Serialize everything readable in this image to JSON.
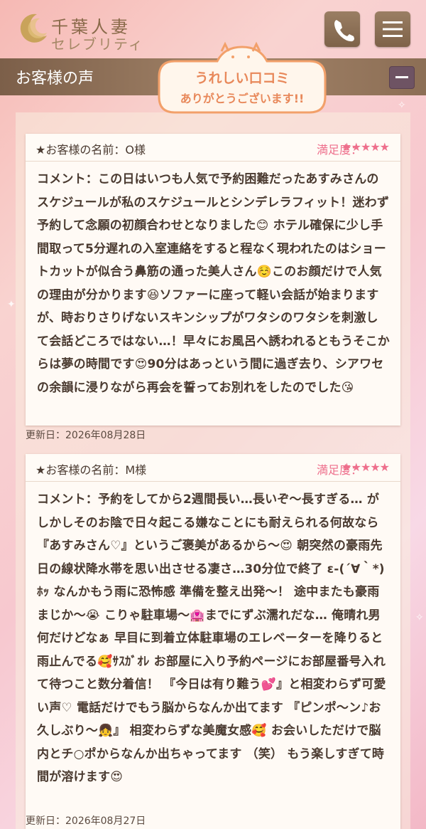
{
  "header": {
    "logo_line1": "千葉人妻",
    "logo_line2": "セレブリティ",
    "phone_icon": "phone-icon",
    "menu_icon": "hamburger-menu-icon"
  },
  "section": {
    "title": "お客様の声",
    "badge_line1": "うれしい口コミ",
    "badge_line2": "ありがとうございます!!",
    "collapse_icon": "minus-icon"
  },
  "reviews": [
    {
      "name": "★お客様の名前：O様",
      "rating_label": "満足度：",
      "stars": "★★★★★",
      "comment": "コメント：この日はいつも人気で予約困難だったあすみさんのスケジュールが私のスケジュールとシンデレラフィット！迷わず予約して念願の初顔合わせとなりました😊 ホテル確保に少し手間取って5分遅れの入室連絡をすると程なく現われたのはショートカットが似合う鼻筋の通った美人さん☺️このお顔だけで人気の理由が分かります😆ソファーに座って軽い会話が始まりますが、時おりさりげないスキンシップがワタシのワタシを刺激して会話どころではない…！早々にお風呂へ誘われるともうそこからは夢の時間です😍90分はあっという間に過ぎ去り、シアワセの余韻に浸りながら再会を誓ってお別れをしたのでした😘",
      "date": "更新日：2026年08月28日"
    },
    {
      "name": "★お客様の名前：M様",
      "rating_label": "満足度：",
      "stars": "★★★★★",
      "comment": "コメント：予約をしてから2週間長い…長いぞ〜長すぎる… がしかしそのお陰で日々起こる嫌なことにも耐えられる何故なら『あすみさん♡』というご褒美があるから〜😍 朝突然の豪雨先日の線状降水帯を思い出させる凄さ…30分位で終了 ε-(´∀｀*)ﾎｯ なんかもう雨に恐怖感 準備を整え出発〜！ 途中またも豪雨まじか〜😭 こりゃ駐車場〜🏩までにずぶ濡れだな… 俺晴れ男何だけどなぁ 早目に到着立体駐車場のエレベーターを降りると雨止んでる🥰ｻｽｶﾞｵﾚ お部屋に入り予約ページにお部屋番号入れて待つこと数分着信！ 『今日は有り難う💕』と相変わらず可愛い声♡ 電話だけでもう脳からなんか出てます 『ピンポ〜ン♪お久しぶり〜👧』 相変わらずな美魔女感🥰 お会いしただけで脳内とチ○ポからなんか出ちゃってます （笑） もう楽しすぎて時間が溶けます😍",
      "date": "更新日：2026年08月27日"
    }
  ]
}
